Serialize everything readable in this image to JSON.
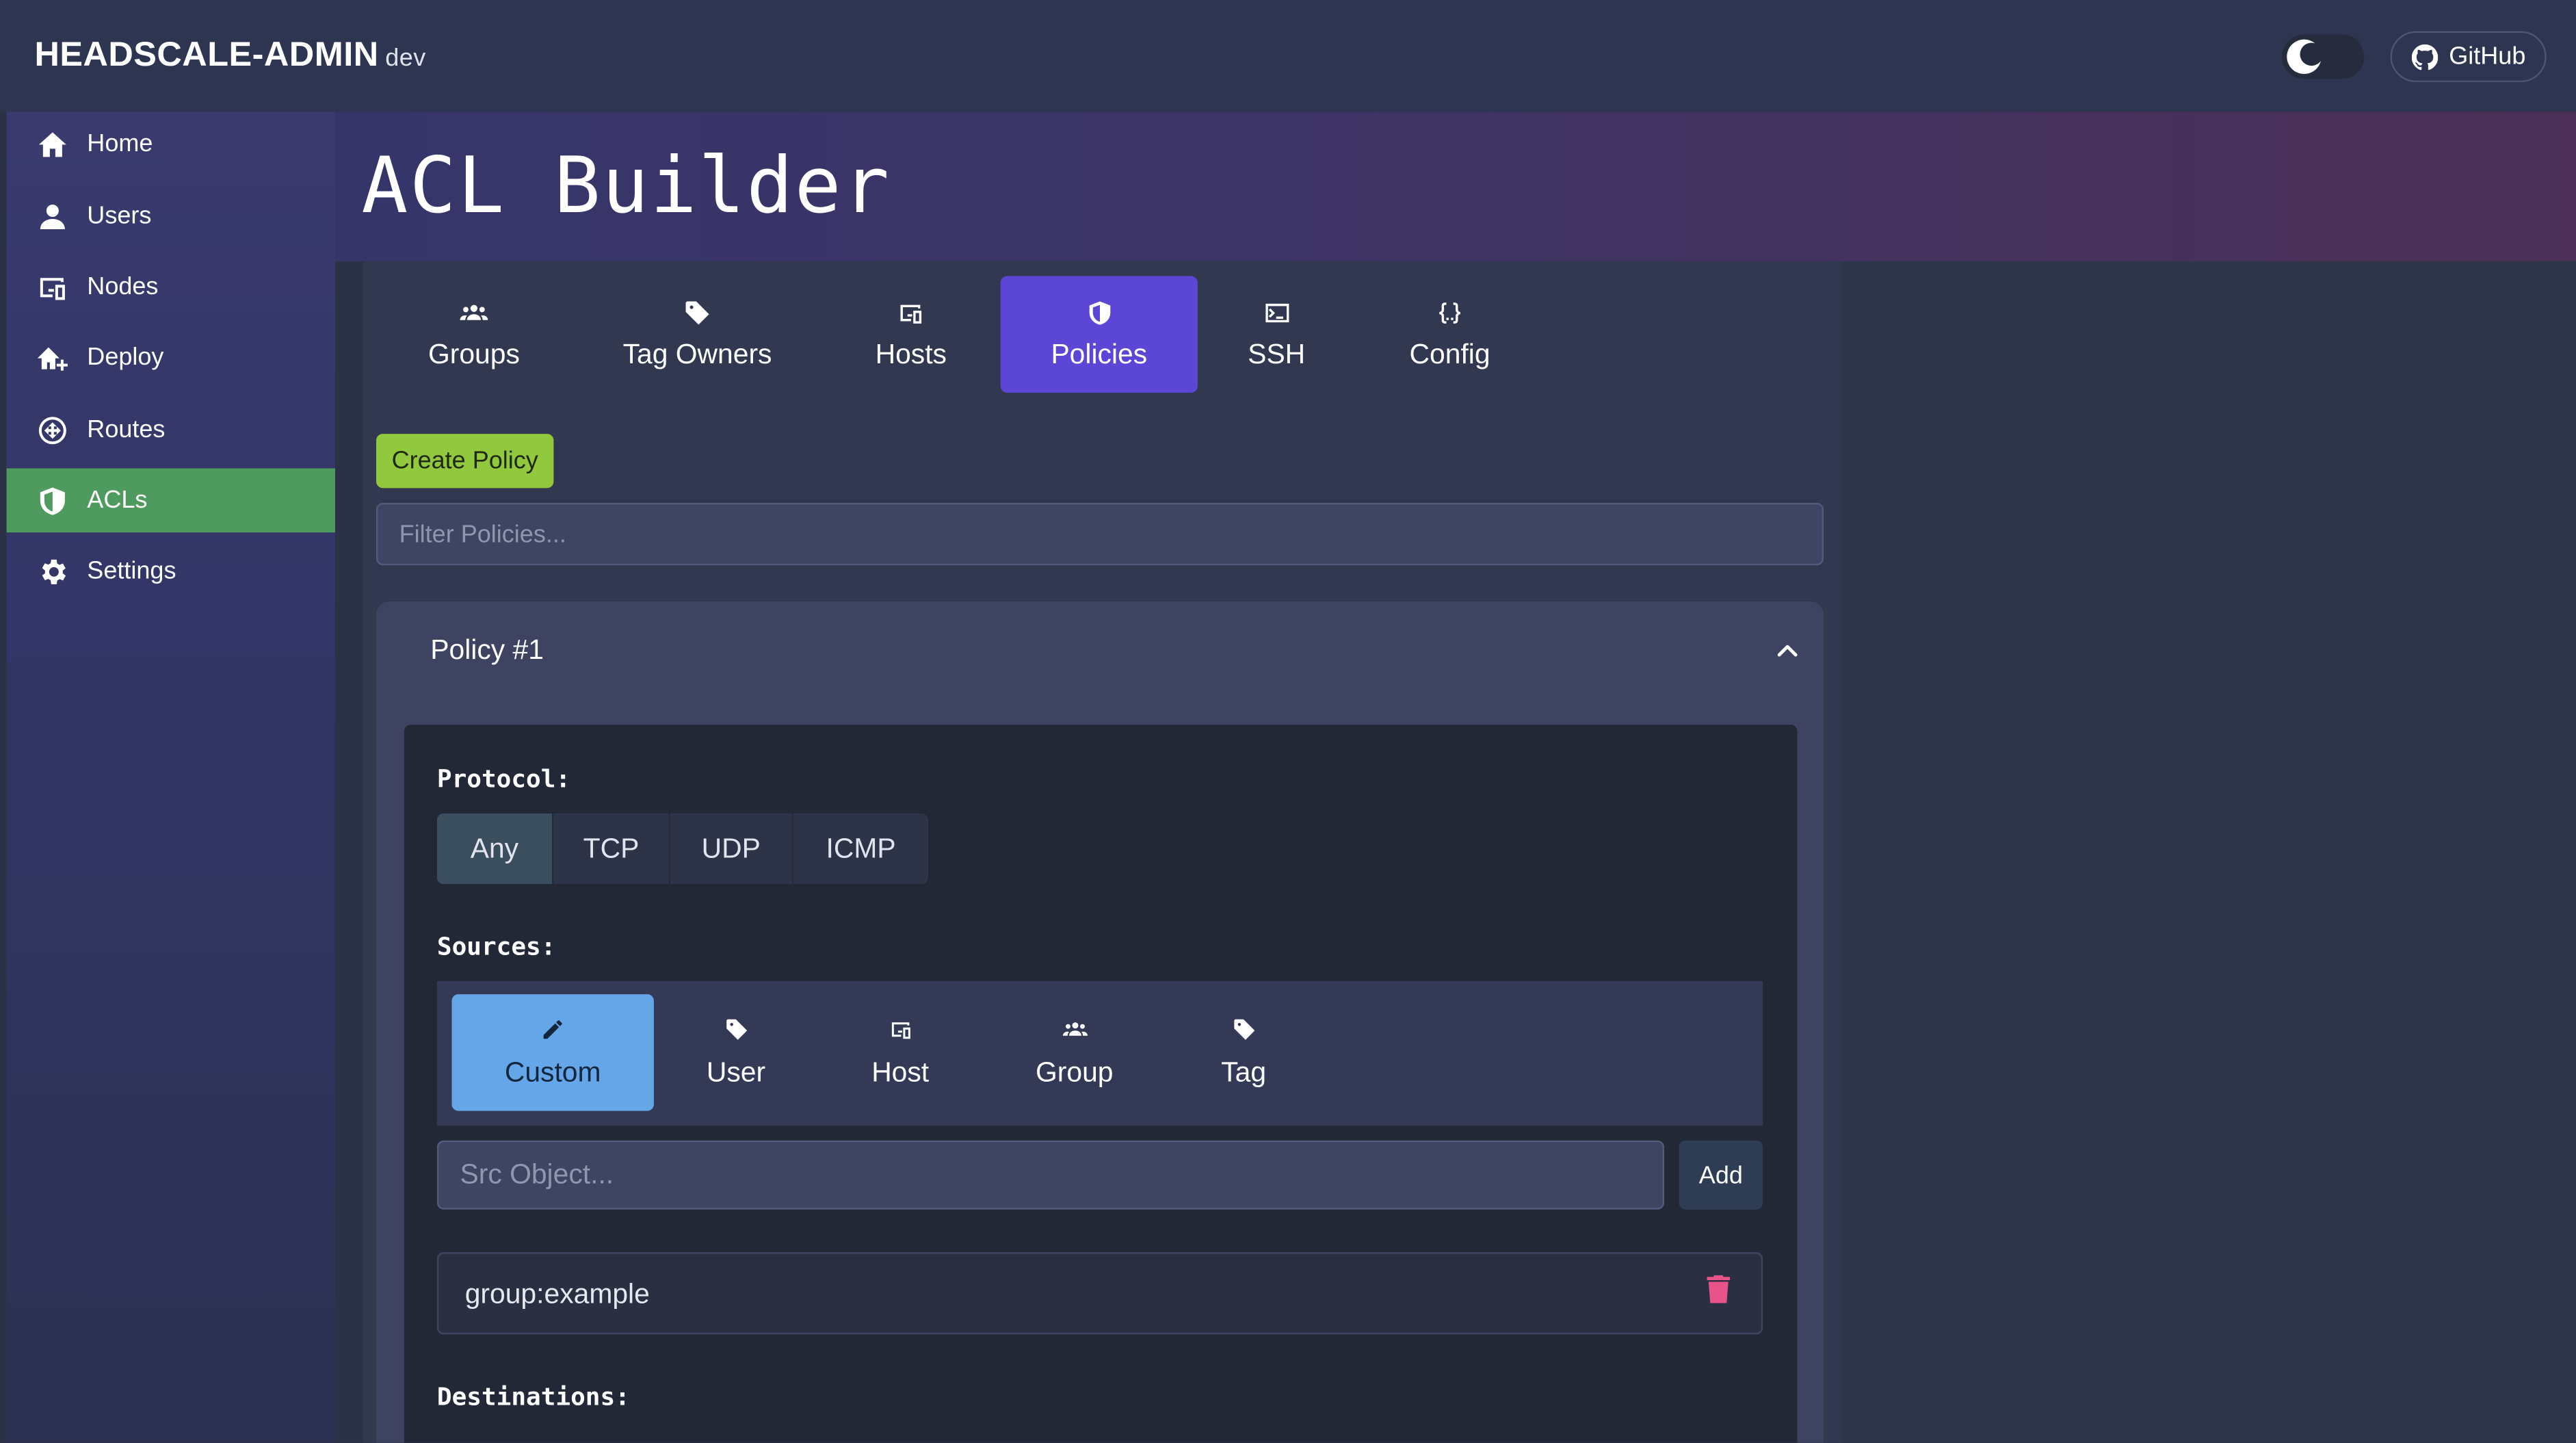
{
  "header": {
    "brand": "HEADSCALE-ADMIN",
    "env": "dev",
    "github_label": "GitHub"
  },
  "sidebar": {
    "items": [
      {
        "label": "Home",
        "icon": "home-icon"
      },
      {
        "label": "Users",
        "icon": "user-icon"
      },
      {
        "label": "Nodes",
        "icon": "devices-icon"
      },
      {
        "label": "Deploy",
        "icon": "deploy-icon"
      },
      {
        "label": "Routes",
        "icon": "routes-icon"
      },
      {
        "label": "ACLs",
        "icon": "shield-icon",
        "active": true
      },
      {
        "label": "Settings",
        "icon": "gear-icon"
      }
    ]
  },
  "page": {
    "title": "ACL Builder"
  },
  "tabs": [
    {
      "label": "Groups",
      "icon": "users-group-icon"
    },
    {
      "label": "Tag Owners",
      "icon": "tag-icon"
    },
    {
      "label": "Hosts",
      "icon": "devices-icon"
    },
    {
      "label": "Policies",
      "icon": "shield-icon",
      "active": true
    },
    {
      "label": "SSH",
      "icon": "terminal-icon"
    },
    {
      "label": "Config",
      "icon": "braces-icon"
    }
  ],
  "policies": {
    "create_label": "Create Policy",
    "filter_placeholder": "Filter Policies...",
    "policy": {
      "title": "Policy #1",
      "protocol_label": "Protocol:",
      "protocols": [
        "Any",
        "TCP",
        "UDP",
        "ICMP"
      ],
      "selected_protocol": "Any",
      "sources_label": "Sources:",
      "source_tabs": [
        {
          "label": "Custom",
          "icon": "pencil-icon",
          "active": true
        },
        {
          "label": "User",
          "icon": "tag-icon"
        },
        {
          "label": "Host",
          "icon": "devices-icon"
        },
        {
          "label": "Group",
          "icon": "users-group-icon"
        },
        {
          "label": "Tag",
          "icon": "tag-icon"
        }
      ],
      "src_placeholder": "Src Object...",
      "add_label": "Add",
      "sources": [
        "group:example"
      ],
      "destinations_label": "Destinations:"
    }
  },
  "colors": {
    "active_nav": "#4f9a5f",
    "active_tab": "#5b46d6",
    "create_button": "#92c83e",
    "active_source_tab": "#64a6e8",
    "delete_icon": "#e8538a"
  }
}
